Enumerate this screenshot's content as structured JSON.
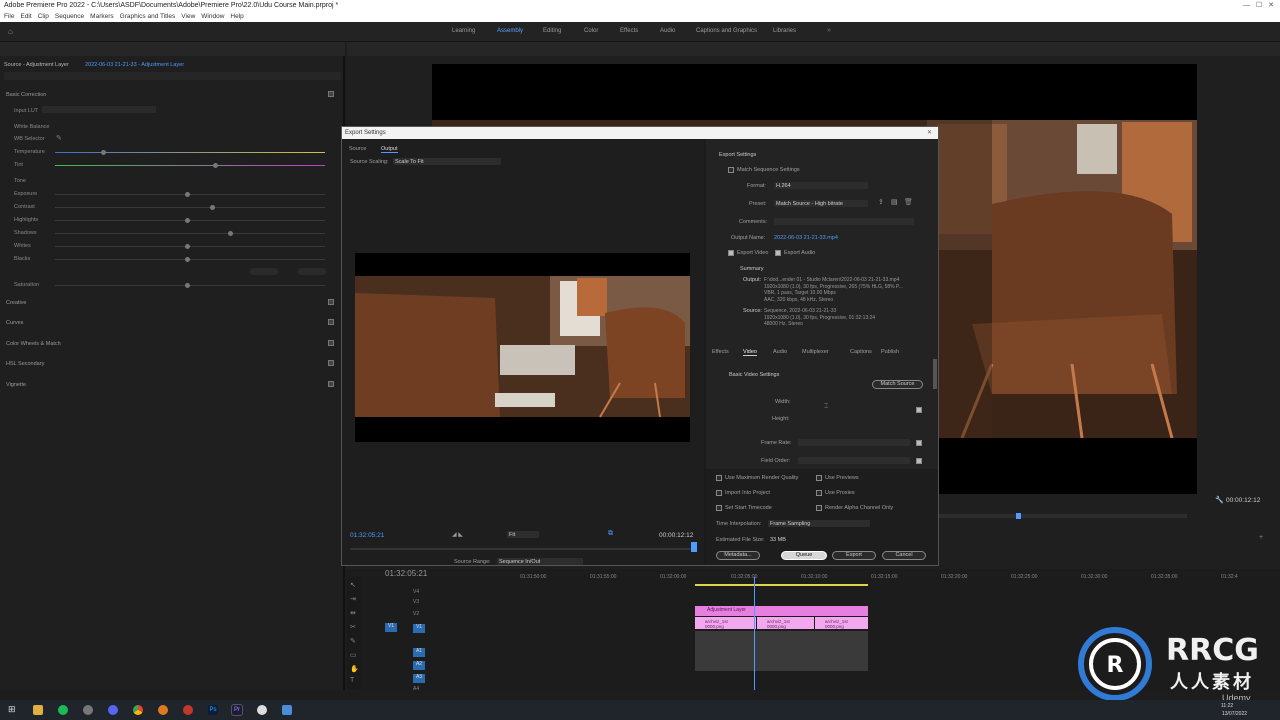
{
  "app": {
    "title": "Adobe Premiere Pro 2022 - C:\\Users\\ASDF\\Documents\\Adobe\\Premiere Pro\\22.0\\Udu Course Main.prproj *",
    "menu": [
      "File",
      "Edit",
      "Clip",
      "Sequence",
      "Markers",
      "Graphics and Titles",
      "View",
      "Window",
      "Help"
    ]
  },
  "workspaces": [
    "Learning",
    "Assembly",
    "Editing",
    "Color",
    "Effects",
    "Audio",
    "Captions and Graphics",
    "Libraries"
  ],
  "lumetri": {
    "source_label": "Source - Adjustment Layer",
    "sequence_label": "2022-06-03 21-21-33 - Adjustment Layer",
    "basic_correction": "Basic Correction",
    "input_lut": "Input LUT",
    "white_balance": "White Balance",
    "wb_selector": "WB Selector",
    "temperature": "Temperature",
    "tint": "Tint",
    "tone": "Tone",
    "exposure": "Exposure",
    "contrast": "Contrast",
    "highlights": "Highlights",
    "shadows": "Shadows",
    "whites": "Whites",
    "blacks": "Blacks",
    "saturation": "Saturation",
    "sections": [
      "Creative",
      "Curves",
      "Color Wheels & Match",
      "HSL Secondary",
      "Vignette"
    ]
  },
  "dialog": {
    "title": "Export Settings",
    "tabs": [
      "Source",
      "Output"
    ],
    "source_scaling_label": "Source Scaling:",
    "source_scaling_value": "Scale To Fit",
    "export_settings": "Export Settings",
    "match_sequence": "Match Sequence Settings",
    "format_label": "Format:",
    "format_value": "H.264",
    "preset_label": "Preset:",
    "preset_value": "Match Source - High bitrate",
    "comments_label": "Comments:",
    "output_name_label": "Output Name:",
    "output_name_value": "2022-06-03 21-21-33.mp4",
    "export_video": "Export Video",
    "export_audio": "Export Audio",
    "summary": "Summary",
    "output_label": "Output:",
    "output_lines": [
      "F:\\dod...ender 01 - Studio Mclaren\\2022-06-03 21-21-33.mp4",
      "1920x1080 (1.0), 30 fps, Progressive, 265 (75% HLG, 58% P...",
      "VBR, 1 pass, Target 10.00 Mbps",
      "AAC, 320 kbps, 48 kHz, Stereo"
    ],
    "source_label": "Source:",
    "source_lines": [
      "Sequence, 2022-06-03 21-21-33",
      "1920x1080 (1.0), 30 fps, Progressive, 01:32:13:24",
      "48000 Hz, Stereo"
    ],
    "settings_tabs": [
      "Effects",
      "Video",
      "Audio",
      "Multiplexer",
      "Captions",
      "Publish"
    ],
    "basic_video_settings": "Basic Video Settings",
    "match_source": "Match Source",
    "width": "Width:",
    "height": "Height:",
    "frame_rate": "Frame Rate:",
    "field_order": "Field Order:",
    "max_render_quality": "Use Maximum Render Quality",
    "use_previews": "Use Previews",
    "import_into_project": "Import Into Project",
    "use_proxies": "Use Proxies",
    "set_start_timecode": "Set Start Timecode",
    "render_alpha": "Render Alpha Channel Only",
    "time_interp_label": "Time Interpolation:",
    "time_interp_value": "Frame Sampling",
    "file_size_label": "Estimated File Size:",
    "file_size_value": "33 MB",
    "buttons": {
      "metadata": "Metadata...",
      "queue": "Queue",
      "export": "Export",
      "cancel": "Cancel"
    },
    "timecode_in": "01:32:05:21",
    "timecode_out": "00:00:12:12",
    "fit": "Fit",
    "source_range_label": "Source Range:",
    "source_range_value": "Sequence In/Out"
  },
  "program": {
    "duration": "00:00:12:12"
  },
  "timeline": {
    "timecode": "01:32:05:21",
    "ruler": [
      "01:31:50:00",
      "01:31:55:00",
      "01:32:00:00",
      "01:32:05:00",
      "01:32:10:00",
      "01:32:15:00",
      "01:32:20:00",
      "01:32:25:00",
      "01:32:30:00",
      "01:32:35:00",
      "01:32:4"
    ],
    "tracks": [
      "V4",
      "V3",
      "V2",
      "V1",
      "A1",
      "A2",
      "A3",
      "A4"
    ],
    "adjustment_clip": "Adjustment Layer",
    "clips": [
      "archviz_1st 0000.png",
      "archviz_1st 0000.png",
      "archviz_1st 0000.png"
    ]
  },
  "watermark": {
    "brand": "RRCG",
    "sub": "人人素材",
    "udemy": "Udemy"
  },
  "clock": {
    "time": "11:22",
    "date": "13/07/2022"
  },
  "colors": {
    "accent": "#4f9bff",
    "clip_pink": "#e77fe0",
    "timeline_yellow": "#e0d44a"
  }
}
